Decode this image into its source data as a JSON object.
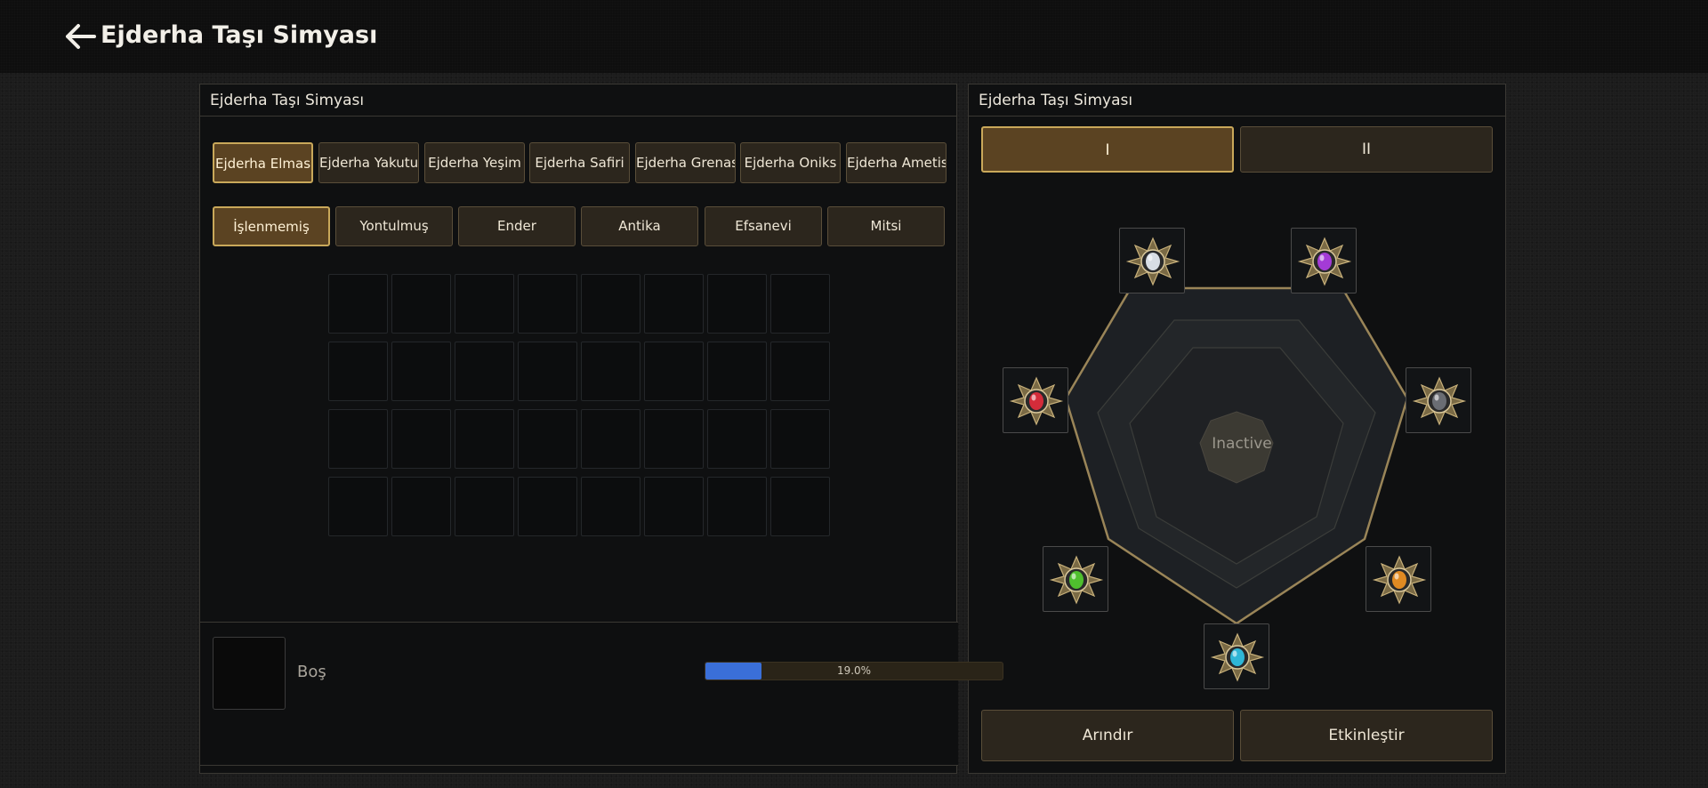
{
  "header": {
    "title": "Ejderha Taşı Simyası"
  },
  "left_panel": {
    "title": "Ejderha Taşı Simyası",
    "stone_tabs": [
      {
        "label": "Ejderha Elmas",
        "active": true
      },
      {
        "label": "Ejderha Yakutu",
        "active": false
      },
      {
        "label": "Ejderha Yeşim",
        "active": false
      },
      {
        "label": "Ejderha Safiri",
        "active": false
      },
      {
        "label": "Ejderha Grenası",
        "active": false
      },
      {
        "label": "Ejderha Oniks",
        "active": false
      },
      {
        "label": "Ejderha Ametist",
        "active": false
      }
    ],
    "grade_tabs": [
      {
        "label": "İşlenmemiş",
        "active": true
      },
      {
        "label": "Yontulmuş",
        "active": false
      },
      {
        "label": "Ender",
        "active": false
      },
      {
        "label": "Antika",
        "active": false
      },
      {
        "label": "Efsanevi",
        "active": false
      },
      {
        "label": "Mitsi",
        "active": false
      }
    ],
    "inventory": {
      "rows": 4,
      "cols": 8
    },
    "selected": {
      "label": "Boş"
    },
    "progress": {
      "value": 0.19,
      "text": "19.0%"
    }
  },
  "right_panel": {
    "title": "Ejderha Taşı Simyası",
    "page_tabs": [
      {
        "label": "I",
        "active": true
      },
      {
        "label": "II",
        "active": false
      }
    ],
    "center_status": "Inactive",
    "gems": [
      {
        "name": "diamond-gem-icon",
        "color": "#d8dde4"
      },
      {
        "name": "amethyst-gem-icon",
        "color": "#a43bd6"
      },
      {
        "name": "onyx-gem-icon",
        "color": "#6a6d73"
      },
      {
        "name": "garnet-gem-icon",
        "color": "#e08a22"
      },
      {
        "name": "sapphire-gem-icon",
        "color": "#2fb6d6"
      },
      {
        "name": "jade-gem-icon",
        "color": "#4fc02e"
      },
      {
        "name": "ruby-gem-icon",
        "color": "#d42c3a"
      }
    ],
    "buttons": {
      "refine": "Arındır",
      "activate": "Etkinleştir"
    }
  }
}
